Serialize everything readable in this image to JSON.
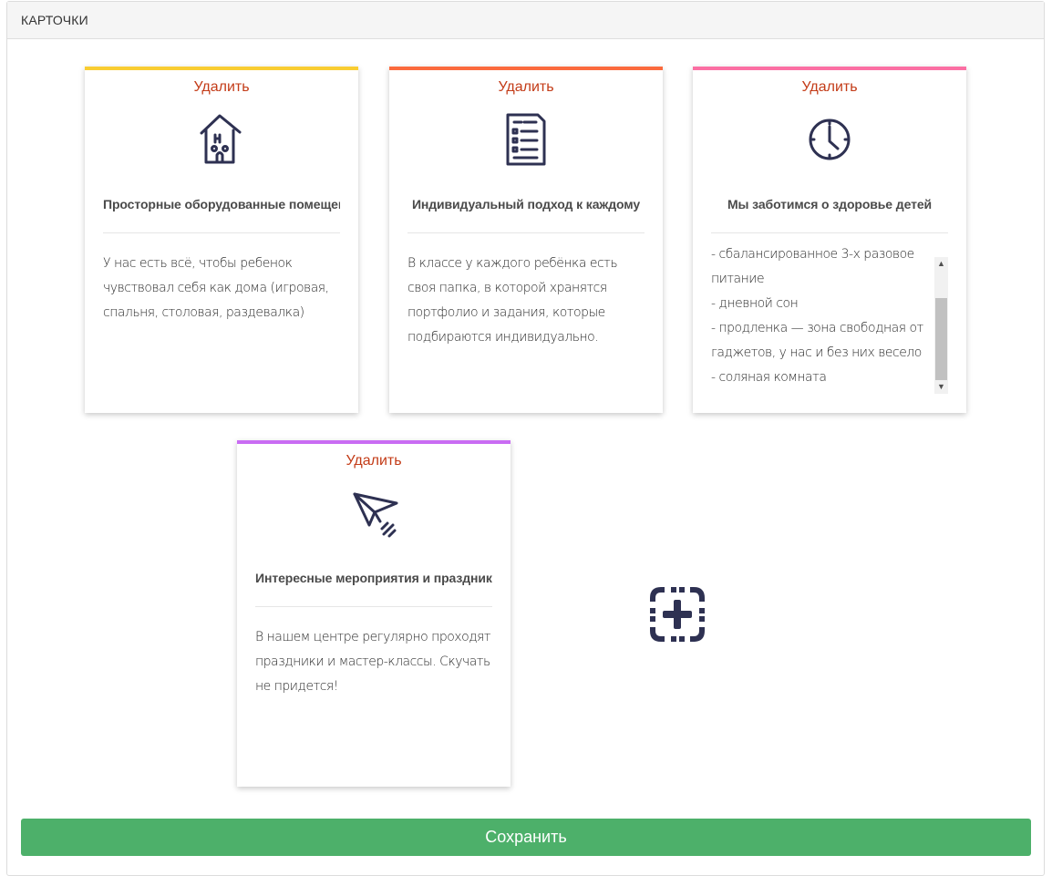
{
  "panel": {
    "title": "КАРТОЧКИ"
  },
  "cards": [
    {
      "delete_label": "Удалить",
      "accent": "#f9cd32",
      "icon": "house-icon",
      "title": "Просторные оборудованные помещения",
      "text": "У нас есть всё, чтобы ребенок чувствовал себя как дома (игровая, спальня, столовая, раздевалка)"
    },
    {
      "delete_label": "Удалить",
      "accent": "#fb6a3d",
      "icon": "document-list-icon",
      "title": "Индивидуальный подход к каждому",
      "text": "В классе у каждого ребёнка есть своя папка, в которой хранятся портфолио и задания, которые подбираются индивидуально."
    },
    {
      "delete_label": "Удалить",
      "accent": "#fb6fa3",
      "icon": "clock-icon",
      "title": "Мы заботимся о здоровье детей",
      "text": "- сбалансированное 3-х разовое питание\n- дневной сон\n- продленка — зона свободная от гаджетов, у нас и без них весело\n- соляная комната"
    },
    {
      "delete_label": "Удалить",
      "accent": "#c96cf3",
      "icon": "paper-plane-icon",
      "title": "Интересные мероприятия и праздники",
      "text": "В нашем центре регулярно проходят праздники и мастер-классы. Скучать не придется!"
    }
  ],
  "add_card": {
    "icon": "add-card-icon"
  },
  "save": {
    "label": "Сохранить",
    "color": "#4db06a"
  }
}
